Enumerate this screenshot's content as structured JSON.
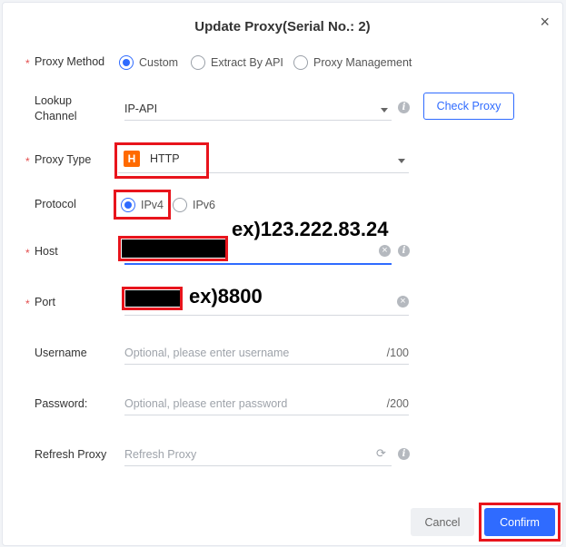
{
  "dialog": {
    "title": "Update Proxy(Serial No.: 2)",
    "close": "×"
  },
  "proxy_method": {
    "label": "Proxy Method",
    "options": [
      "Custom",
      "Extract By API",
      "Proxy Management"
    ],
    "selected": "Custom"
  },
  "lookup_channel": {
    "label_line1": "Lookup",
    "label_line2": "Channel",
    "value": "IP-API",
    "check_button": "Check Proxy"
  },
  "proxy_type": {
    "label": "Proxy Type",
    "badge": "H",
    "value": "HTTP"
  },
  "protocol": {
    "label": "Protocol",
    "options": [
      "IPv4",
      "IPv6"
    ],
    "selected": "IPv4"
  },
  "host": {
    "label": "Host",
    "annotation": "ex)123.222.83.24"
  },
  "port": {
    "label": "Port",
    "annotation": "ex)8800"
  },
  "username": {
    "label": "Username",
    "placeholder": "Optional, please enter username",
    "counter": "/100"
  },
  "password": {
    "label": "Password:",
    "placeholder": "Optional, please enter password",
    "counter": "/200"
  },
  "refresh_proxy": {
    "label": "Refresh Proxy",
    "placeholder": "Refresh Proxy"
  },
  "footer": {
    "cancel": "Cancel",
    "confirm": "Confirm"
  },
  "colors": {
    "accent": "#2f6bff",
    "highlight": "#e8141c",
    "badge": "#ff6a00"
  }
}
